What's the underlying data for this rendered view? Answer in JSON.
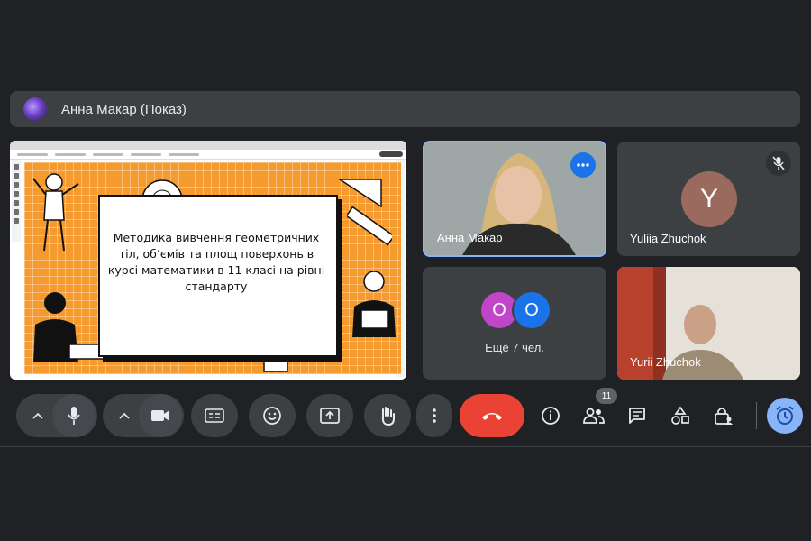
{
  "presenter": {
    "name": "Анна Макар (Показ)"
  },
  "slide": {
    "title": "Методика вивчення геометричних тіл, об’ємів та площ поверхонь в курсі математики в 11 класі на рівні стандарту"
  },
  "tiles": {
    "anna": {
      "name": "Анна Макар",
      "more_icon": "more-horiz-icon"
    },
    "yuliia": {
      "name": "Yuliia Zhuchok",
      "initial": "Y",
      "avatar_color": "#9b6a5e",
      "muted_icon": "mic-off-icon"
    },
    "more": {
      "label": "Ещё 7 чел.",
      "avatars": [
        {
          "initial": "O",
          "color": "#c045c9"
        },
        {
          "initial": "O",
          "color": "#1a73e8"
        }
      ]
    },
    "yurii": {
      "name": "Yurii Zhuchok"
    }
  },
  "controls": {
    "participants_count": "11",
    "end_call_color": "#ea4335",
    "accent": "#8ab4f8",
    "buttons": [
      "mic",
      "camera",
      "captions",
      "emoji",
      "present",
      "raise-hand",
      "more",
      "end-call",
      "info",
      "people",
      "chat",
      "activities",
      "host-controls",
      "timer"
    ]
  }
}
